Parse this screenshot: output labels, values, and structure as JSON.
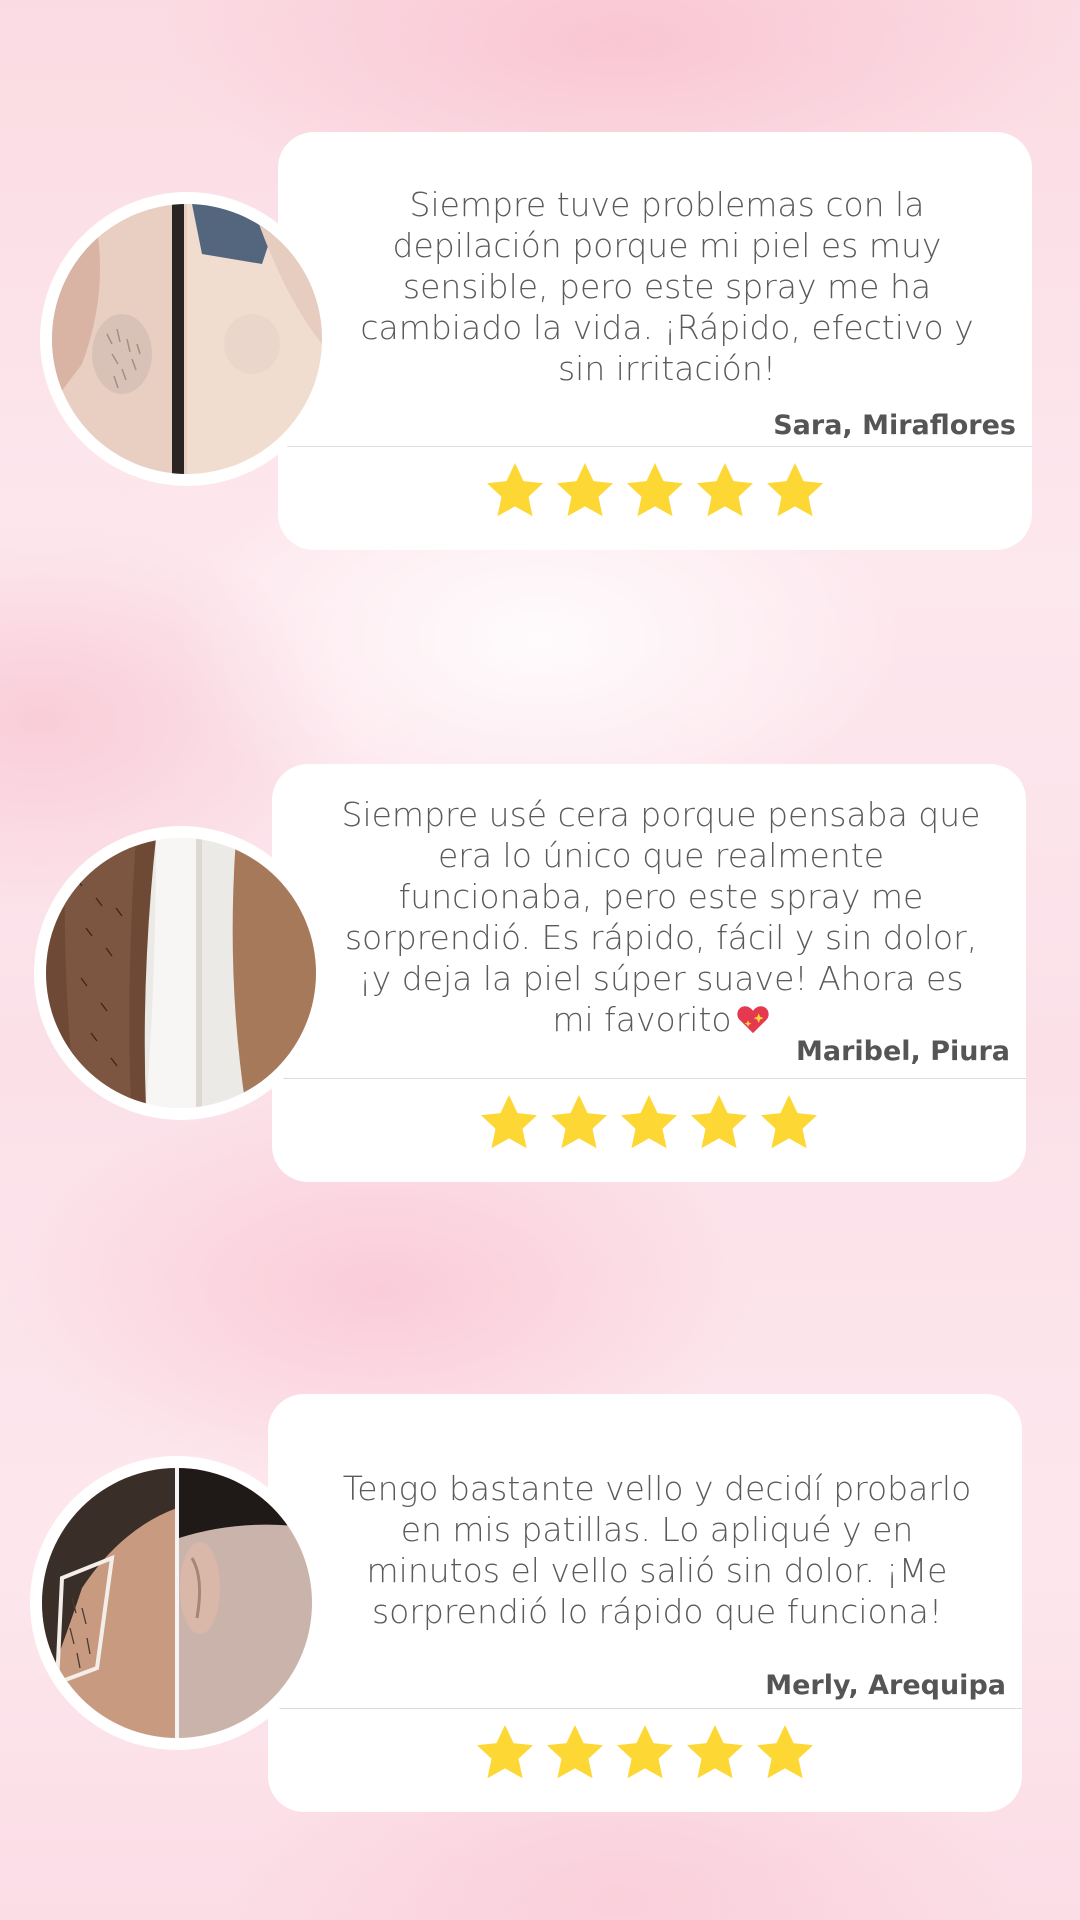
{
  "reviews": [
    {
      "quote": "Siempre tuve problemas con la depilación porque mi piel es muy sensible, pero este spray me ha cambiado la vida. ¡Rápido, efectivo y sin irritación!",
      "author": "Sara, Miraflores",
      "rating": 5,
      "photo": "underarm-before-after-photo"
    },
    {
      "quote": "Siempre usé cera porque pensaba que era lo único que realmente funcionaba, pero este spray me sorprendió. Es rápido, fácil y sin dolor, ¡y deja la piel súper suave! Ahora es mi favorito",
      "author": "Maribel, Piura",
      "rating": 5,
      "photo": "arm-before-after-photo",
      "emoji": "sparkling-heart-icon"
    },
    {
      "quote": "Tengo bastante vello y decidí probarlo en mis patillas. Lo apliqué y en minutos el vello salió sin dolor. ¡Me sorprendió lo rápido que funciona!",
      "author": "Merly, Arequipa",
      "rating": 5,
      "photo": "sideburn-before-after-photo"
    }
  ],
  "colors": {
    "star": "#fdd835",
    "text": "#5a5a5a",
    "card": "#ffffff",
    "background": "#fbdde6"
  }
}
